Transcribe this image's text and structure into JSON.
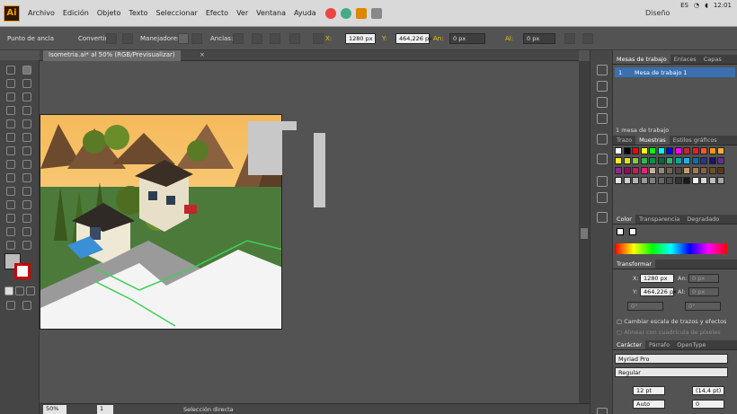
{
  "menu": {
    "logo": "Ai",
    "items": [
      "Archivo",
      "Edición",
      "Objeto",
      "Texto",
      "Seleccionar",
      "Efecto",
      "Ver",
      "Ventana",
      "Ayuda"
    ],
    "workspace": "Diseño",
    "system": {
      "lang": "ES",
      "time": "12:01"
    }
  },
  "control": {
    "selection_label": "Punto de ancla",
    "convert_label": "Convertir:",
    "handles_label": "Manejadores:",
    "anchors_label": "Anclas:",
    "x_label": "X:",
    "x_value": "1280 px",
    "y_label": "Y:",
    "y_value": "464,226 px",
    "w_label": "An:",
    "w_value": "0 px",
    "h_label": "Al:",
    "h_value": "0 px"
  },
  "document": {
    "tab": "Isometria.ai* al 50% (RGB/Previsualizar)"
  },
  "status": {
    "zoom": "50%",
    "page": "1",
    "tool": "Selección directa"
  },
  "artboards_panel": {
    "tabs": [
      "Mesas de trabajo",
      "Enlaces",
      "Capas"
    ],
    "row_index": "1",
    "row_name": "Mesa de trabajo 1",
    "footer": "1 mesa de trabajo"
  },
  "swatches_panel": {
    "tabs": [
      "Trazo",
      "Muestras",
      "Estilos gráficos"
    ]
  },
  "color_panel": {
    "tabs": [
      "Color",
      "Transparencia",
      "Degradado"
    ]
  },
  "transform_panel": {
    "title": "Transformar",
    "x_label": "X:",
    "x_value": "1280 px",
    "y_label": "Y:",
    "y_value": "464,226 px",
    "w_label": "An:",
    "w_value": "0 px",
    "h_label": "Al:",
    "h_value": "0 px",
    "angle1": "0°",
    "angle2": "0°",
    "scale_strokes": "Cambiar escala de trazos y efectos",
    "align_grid": "Alinear con cuadrícula de píxeles"
  },
  "char_panel": {
    "tabs": [
      "Carácter",
      "Párrafo",
      "OpenType"
    ],
    "font": "Myriad Pro",
    "style": "Regular",
    "size": "12 pt",
    "leading": "(14,4 pt)",
    "kerning": "Auto",
    "tracking": "0"
  },
  "colors": {
    "ui_dark": "#535353",
    "menubar": "#d9d9d9",
    "ai_orange": "#ff9a00"
  }
}
